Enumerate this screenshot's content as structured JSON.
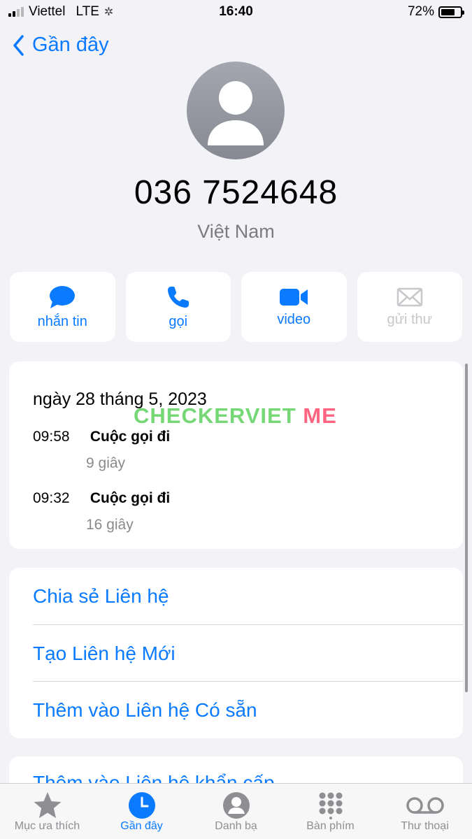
{
  "status": {
    "carrier": "Viettel",
    "network": "LTE",
    "time": "16:40",
    "battery": "72%",
    "battery_level": 0.72
  },
  "nav": {
    "back_label": "Gần đây"
  },
  "contact": {
    "number": "036 7524648",
    "country": "Việt Nam"
  },
  "actions": [
    {
      "label": "nhắn tin",
      "icon": "message-icon",
      "enabled": true
    },
    {
      "label": "gọi",
      "icon": "phone-icon",
      "enabled": true
    },
    {
      "label": "video",
      "icon": "video-icon",
      "enabled": true
    },
    {
      "label": "gửi thư",
      "icon": "mail-icon",
      "enabled": false
    }
  ],
  "history": {
    "date": "ngày 28 tháng 5, 2023",
    "calls": [
      {
        "time": "09:58",
        "type": "Cuộc gọi đi",
        "duration": "9 giây"
      },
      {
        "time": "09:32",
        "type": "Cuộc gọi đi",
        "duration": "16 giây"
      }
    ]
  },
  "watermark": {
    "text": "CHECKERVIET",
    "suffix": "ME"
  },
  "options": [
    "Chia sẻ Liên hệ",
    "Tạo Liên hệ Mới",
    "Thêm vào Liên hệ Có sẵn"
  ],
  "partial_option": "Thêm vào Liên hệ khẩn cấp",
  "tabs": [
    {
      "label": "Mục ưa thích",
      "icon": "star-icon"
    },
    {
      "label": "Gần đây",
      "icon": "clock-icon",
      "active": true
    },
    {
      "label": "Danh bạ",
      "icon": "contacts-icon"
    },
    {
      "label": "Bàn phím",
      "icon": "keypad-icon"
    },
    {
      "label": "Thư thoại",
      "icon": "voicemail-icon"
    }
  ],
  "colors": {
    "accent": "#0a7aff",
    "background": "#f2f2f7",
    "secondary_text": "#8a8a8e"
  }
}
